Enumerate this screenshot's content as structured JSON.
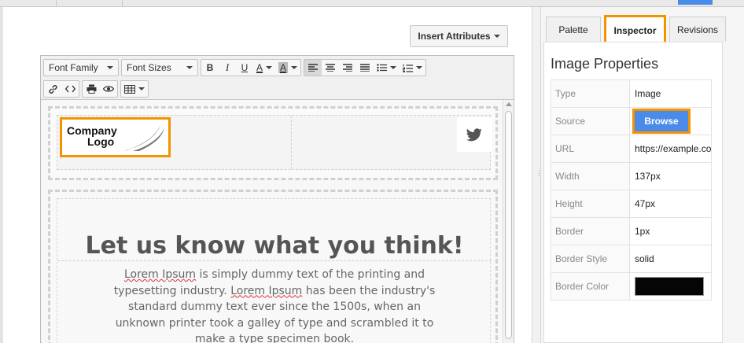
{
  "toolbar": {
    "insert_attributes": "Insert Attributes",
    "font_family": "Font Family",
    "font_sizes": "Font Sizes",
    "bold": "B",
    "italic": "I",
    "underline": "U",
    "text_color": "A",
    "bg_color": "A"
  },
  "content": {
    "logo_line1": "Company",
    "logo_line2": "Logo",
    "headline": "Let us know what you think!",
    "para_parts": [
      "Lorem Ipsum",
      " is simply dummy text of the printing and typesetting industry. ",
      "Lorem Ipsum",
      " has been the industry's standard dummy text ever since the 1500s, when an unknown printer took a galley of type and scrambled it to make a type specimen book."
    ]
  },
  "panel": {
    "tabs": [
      "Palette",
      "Inspector",
      "Revisions"
    ],
    "title": "Image Properties",
    "props": [
      {
        "key": "Type",
        "value": "Image"
      },
      {
        "key": "Source",
        "value": "Browse"
      },
      {
        "key": "URL",
        "value": "https://example.co"
      },
      {
        "key": "Width",
        "value": "137px"
      },
      {
        "key": "Height",
        "value": "47px"
      },
      {
        "key": "Border",
        "value": "1px"
      },
      {
        "key": "Border Style",
        "value": "solid"
      },
      {
        "key": "Border Color",
        "value": "#050505"
      }
    ]
  },
  "colors": {
    "highlight": "#f29400",
    "accent": "#4a8be9"
  },
  "icons": {
    "twitter": "twitter-icon",
    "link": "link-icon",
    "code": "code-icon",
    "print": "print-icon",
    "preview": "eye-icon",
    "table": "table-icon"
  }
}
